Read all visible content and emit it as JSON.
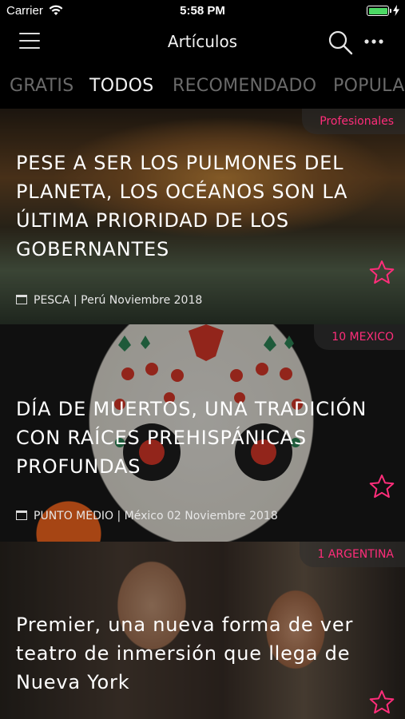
{
  "status_bar": {
    "carrier": "Carrier",
    "time": "5:58 PM",
    "battery_level": 1.0,
    "battery_color": "#4cd964"
  },
  "nav": {
    "title": "Artículos",
    "left_icon": "hamburger-menu-icon",
    "right_icons": [
      "search-icon",
      "more-dots-icon"
    ]
  },
  "tabs": [
    {
      "label": "GRATIS",
      "active": false
    },
    {
      "label": "TODOS",
      "active": true
    },
    {
      "label": "RECOMENDADO",
      "active": false
    },
    {
      "label": "POPULAR",
      "active": false
    }
  ],
  "articles": [
    {
      "tag": "Profesionales",
      "title": "PESE A SER LOS PULMONES DEL PLANETA, LOS OCÉANOS SON LA ÚLTIMA PRIORIDAD DE LOS GOBERNANTES",
      "meta": "PESCA | Perú Noviembre 2018"
    },
    {
      "tag": "10 MEXICO",
      "title": "DÍA DE MUERTOS, UNA TRADICIÓN CON RAÍCES PREHISPÁNICAS PROFUNDAS",
      "meta": "PUNTO MEDIO | México 02 Noviembre 2018"
    },
    {
      "tag": "1 ARGENTINA",
      "title": "Premier, una nueva forma de ver teatro de inmersión que llega de Nueva York",
      "meta": ""
    }
  ],
  "colors": {
    "accent": "#ff2d7a",
    "tab_inactive": "#6a6a6a",
    "tab_active": "#f2f2f2",
    "background": "#000000"
  }
}
